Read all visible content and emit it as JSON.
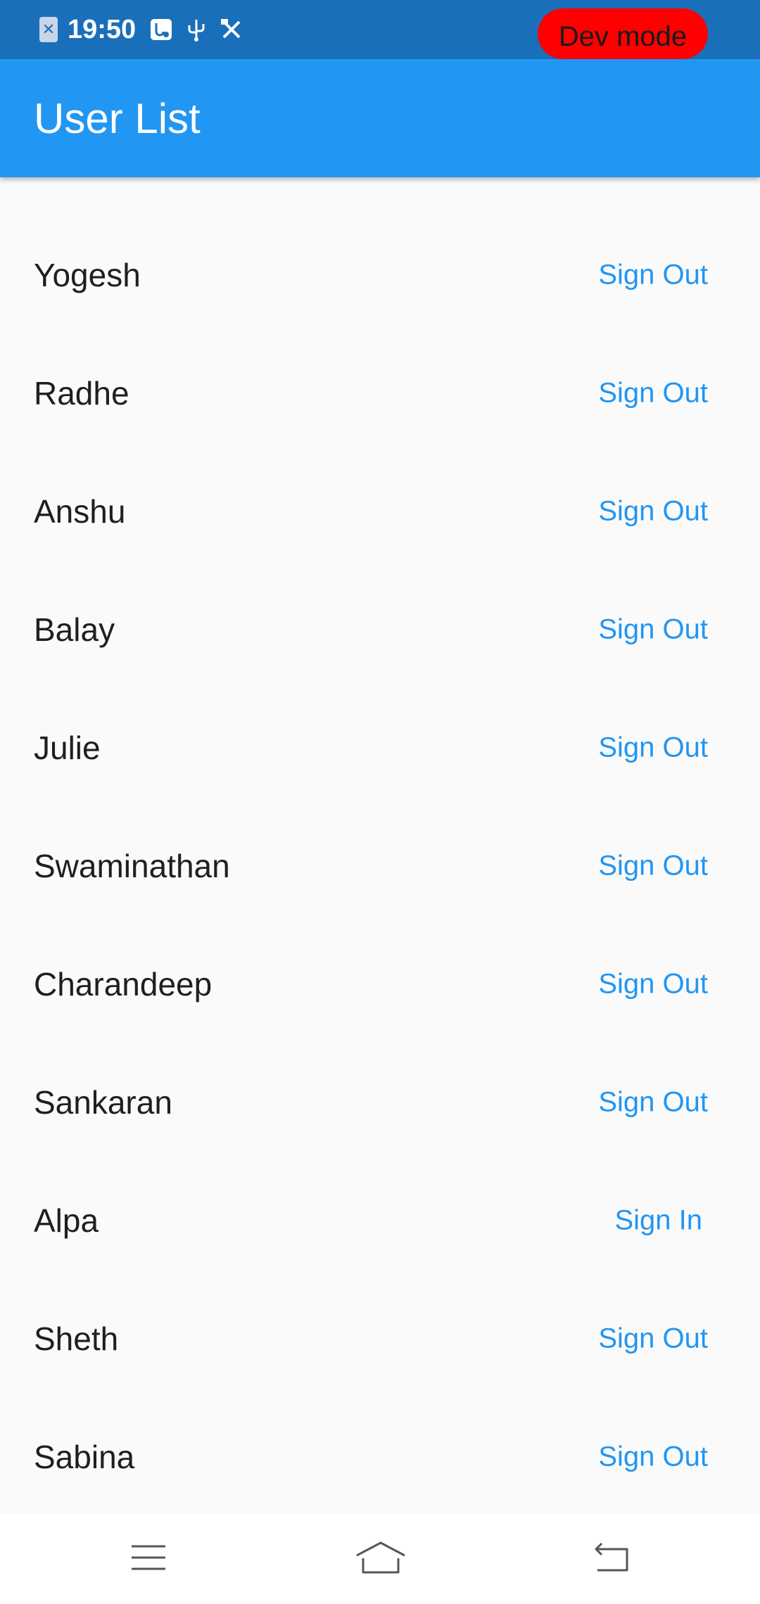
{
  "status_bar": {
    "time": "19:50",
    "sim_icon": "sim-card-icon",
    "icons": [
      "usb-settings-icon",
      "usb-icon",
      "developer-tools-icon"
    ],
    "dev_mode_label": "Dev mode",
    "background_color": "#1a6fba",
    "dev_mode_color": "#ff0000"
  },
  "app_bar": {
    "title": "User List",
    "background_color": "#2196f3"
  },
  "users": [
    {
      "name": "Yogesh",
      "action": "Sign Out"
    },
    {
      "name": "Radhe",
      "action": "Sign Out"
    },
    {
      "name": "Anshu",
      "action": "Sign Out"
    },
    {
      "name": "Balay",
      "action": "Sign Out"
    },
    {
      "name": "Julie",
      "action": "Sign Out"
    },
    {
      "name": "Swaminathan",
      "action": "Sign Out"
    },
    {
      "name": "Charandeep",
      "action": "Sign Out"
    },
    {
      "name": "Sankaran",
      "action": "Sign Out"
    },
    {
      "name": "Alpa",
      "action": "Sign In"
    },
    {
      "name": "Sheth",
      "action": "Sign Out"
    },
    {
      "name": "Sabina",
      "action": "Sign Out"
    }
  ],
  "action_color": "#2196f3",
  "nav_bar": {
    "buttons": [
      "menu-icon",
      "home-icon",
      "back-icon"
    ]
  }
}
